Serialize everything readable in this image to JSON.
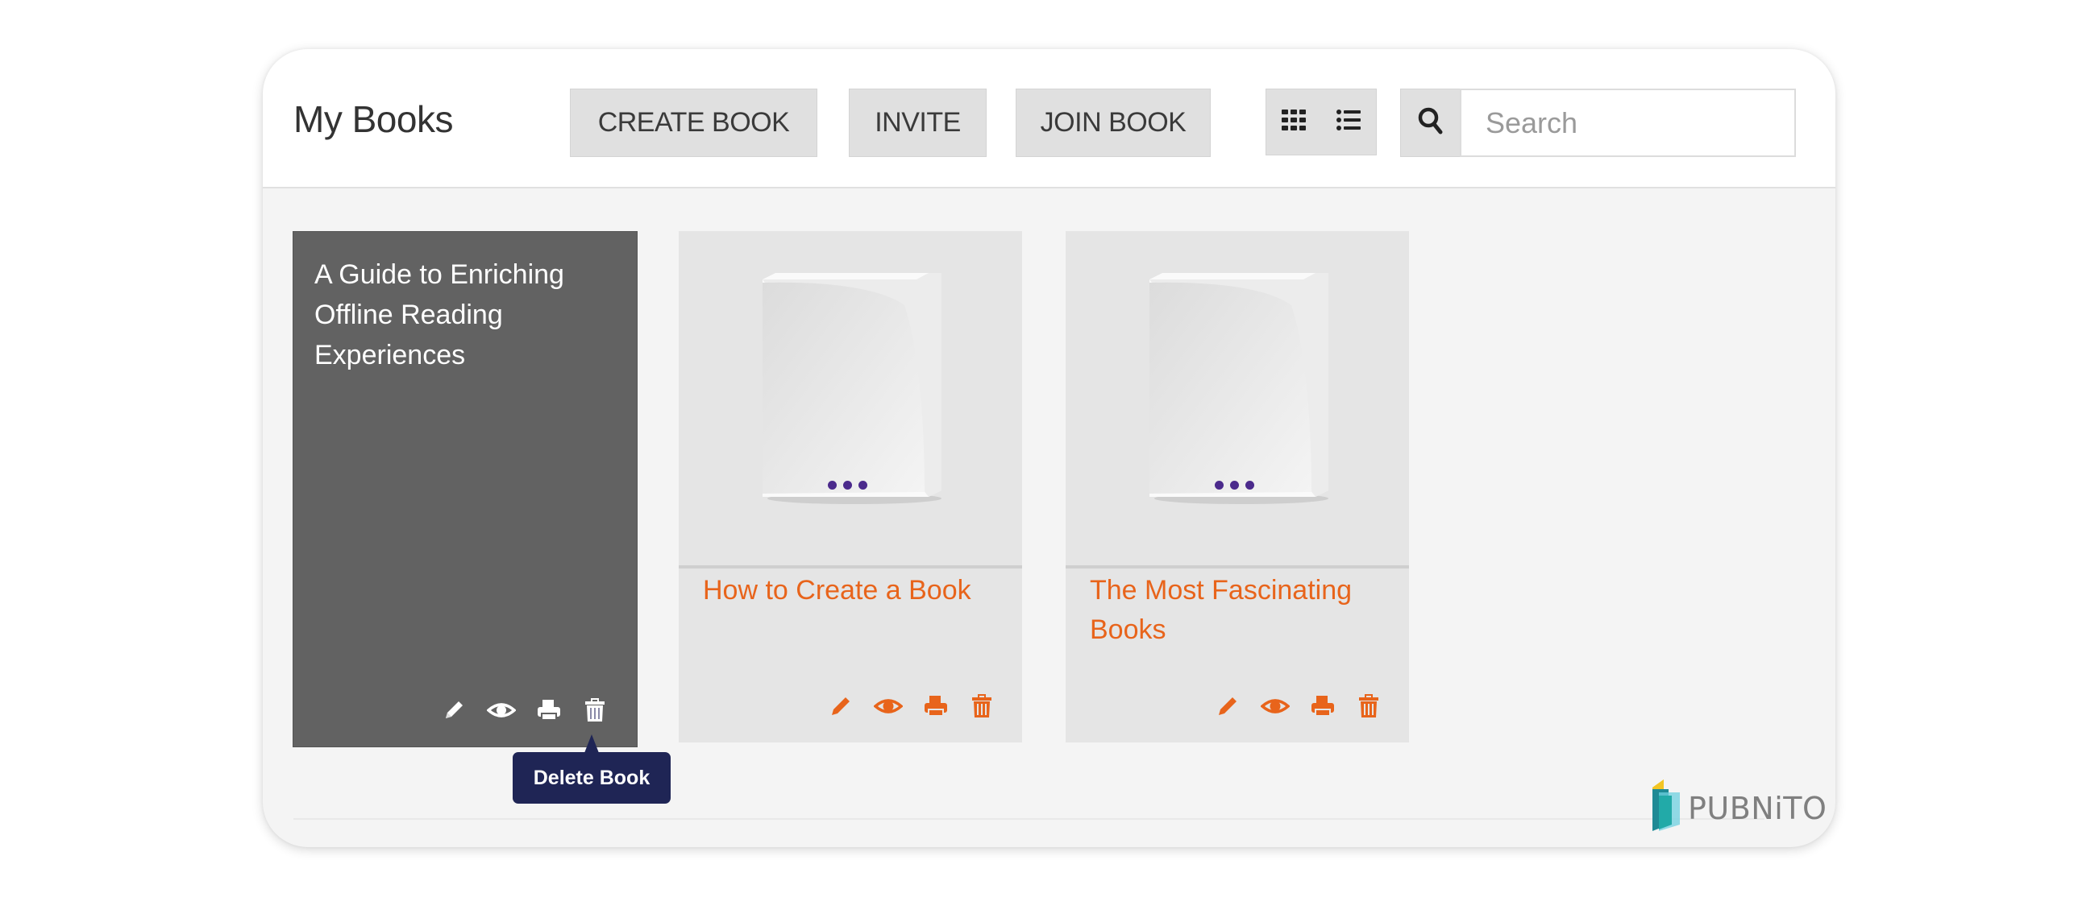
{
  "header": {
    "title": "My Books",
    "buttons": {
      "create": "CREATE BOOK",
      "invite": "INVITE",
      "join": "JOIN BOOK"
    },
    "view_toggle": {
      "grid_icon": "grid-view-icon",
      "list_icon": "list-view-icon"
    },
    "search": {
      "icon": "search-icon",
      "placeholder": "Search",
      "value": ""
    }
  },
  "books": [
    {
      "title": "A Guide to Enriching Offline Reading Experiences",
      "state": "hovered",
      "actions": [
        "edit",
        "view",
        "print",
        "delete"
      ]
    },
    {
      "title": "How to Create a Book",
      "actions": [
        "edit",
        "view",
        "print",
        "delete"
      ]
    },
    {
      "title": "The Most Fascinating Books",
      "actions": [
        "edit",
        "view",
        "print",
        "delete"
      ]
    }
  ],
  "tooltip": {
    "text": "Delete Book"
  },
  "brand": {
    "name": "PUBNiTO"
  },
  "colors": {
    "accent": "#e8641b",
    "tooltip_bg": "#1f2555",
    "hover_card": "#626262",
    "cover_dots": "#4b2a8c"
  }
}
